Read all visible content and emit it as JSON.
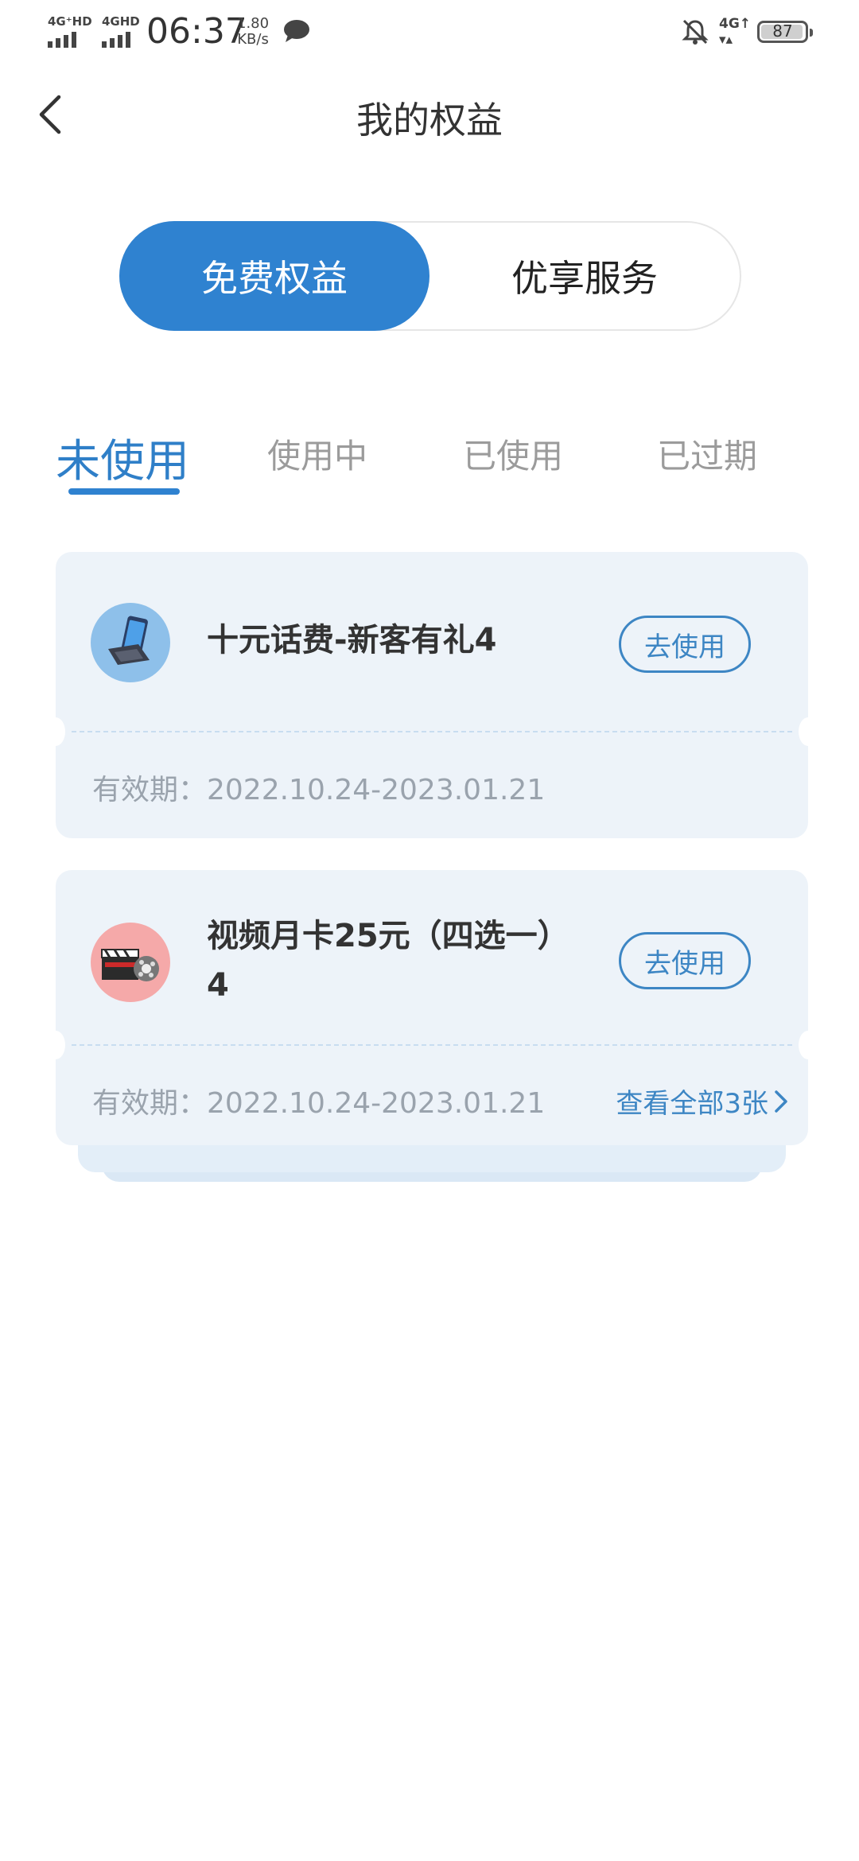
{
  "status_bar": {
    "sim1": "4G⁺HD",
    "sim2": "4GHD",
    "time": "06:37",
    "speed_value": "1.80",
    "speed_unit": "KB/s",
    "network": "4G",
    "battery": "87"
  },
  "header": {
    "title": "我的权益"
  },
  "segment": {
    "active": "免费权益",
    "other": "优享服务"
  },
  "tabs": [
    "未使用",
    "使用中",
    "已使用",
    "已过期"
  ],
  "cards": [
    {
      "title": "十元话费-新客有礼4",
      "button": "去使用",
      "validity": "有效期：2022.10.24-2023.01.21",
      "icon": "phone-icon"
    },
    {
      "title_line1": "视频月卡25元（四选一）",
      "title_line2": "4",
      "button": "去使用",
      "validity": "有效期：2022.10.24-2023.01.21",
      "more": "查看全部3张",
      "icon": "film-clapper-icon"
    }
  ],
  "colors": {
    "accent": "#2f82d0",
    "card_bg": "#edf3f9",
    "muted": "#9b9b9b"
  }
}
